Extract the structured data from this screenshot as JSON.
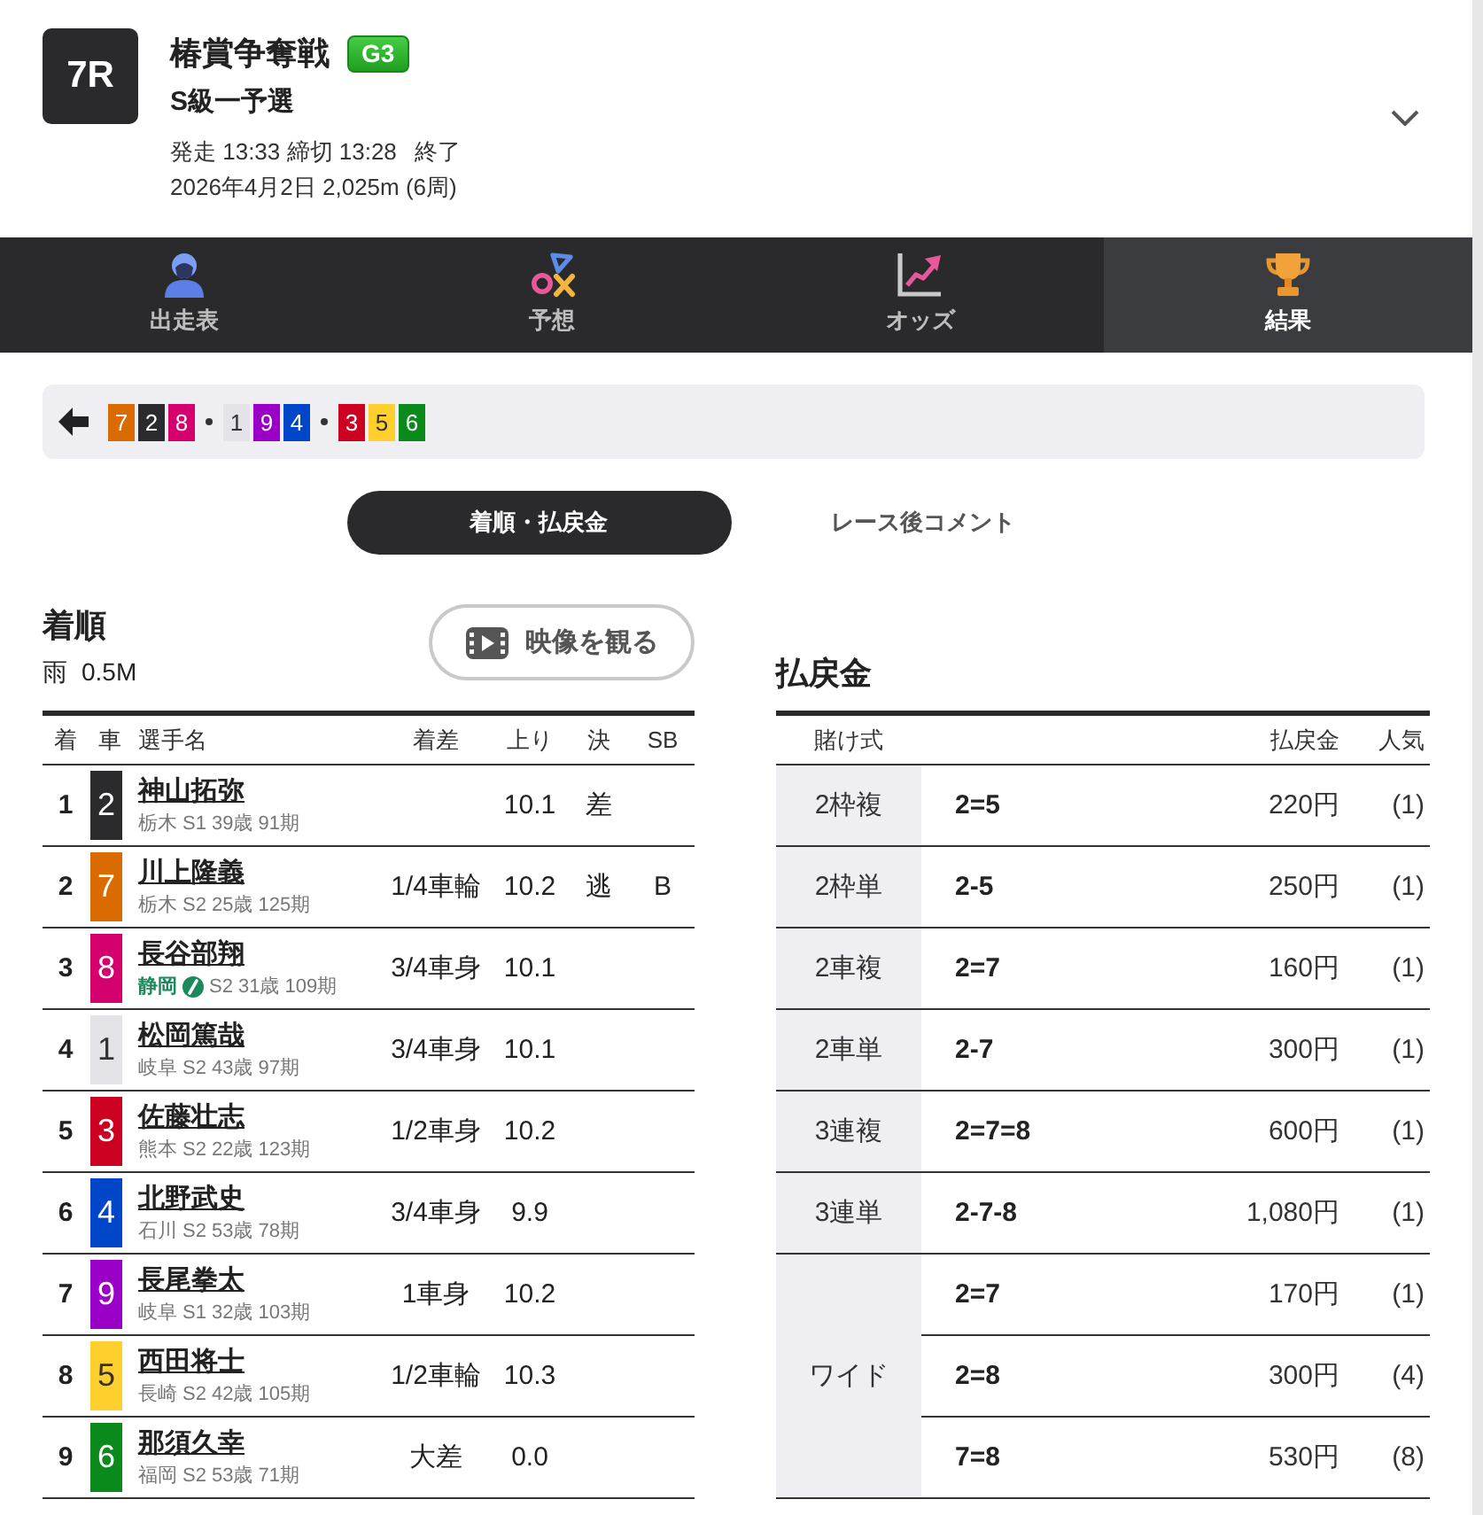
{
  "race": {
    "number": "7R",
    "title": "椿賞争奪戦",
    "grade": "G3",
    "class": "S級一予選",
    "schedule": "発走 13:33 締切 13:28",
    "status": "終了",
    "details": "2026年4月2日 2,025m (6周)"
  },
  "nav_tabs": [
    {
      "kind": "entries",
      "label": "出走表",
      "selected": false
    },
    {
      "kind": "prediction",
      "label": "予想",
      "selected": false
    },
    {
      "kind": "odds",
      "label": "オッズ",
      "selected": false
    },
    {
      "kind": "results",
      "label": "結果",
      "selected": true
    }
  ],
  "position_line": {
    "groups": [
      [
        {
          "number": "7",
          "color": "#d96b00"
        },
        {
          "number": "2",
          "color": "#2b2b2e"
        },
        {
          "number": "8",
          "color": "#d4006e"
        }
      ],
      [
        {
          "number": "1",
          "color": "#e3e3e8"
        },
        {
          "number": "9",
          "color": "#9a00c6"
        },
        {
          "number": "4",
          "color": "#0046c8"
        }
      ],
      [
        {
          "number": "3",
          "color": "#cc0020"
        },
        {
          "number": "5",
          "color": "#ffcf2e"
        },
        {
          "number": "6",
          "color": "#0b8a1c"
        }
      ]
    ]
  },
  "view_tabs": [
    {
      "label": "着順・払戻金",
      "selected": true
    },
    {
      "label": "レース後コメント",
      "selected": false
    }
  ],
  "finish": {
    "title": "着順",
    "weather": "雨",
    "wind": "0.5M",
    "video_button": "映像を観る",
    "columns": [
      "着",
      "車",
      "選手名",
      "着差",
      "上り",
      "決",
      "SB"
    ],
    "rows": [
      {
        "rank": "1",
        "car": "2",
        "color": "#2b2b2e",
        "name": "神山拓弥",
        "region": "栃木",
        "local": false,
        "profile": "S1 39歳 91期",
        "last_lap": "10.1",
        "move": "差"
      },
      {
        "rank": "2",
        "car": "7",
        "color": "#d96b00",
        "name": "川上隆義",
        "region": "栃木",
        "local": false,
        "profile": "S2 25歳 125期",
        "margin": "1/4車輪",
        "last_lap": "10.2",
        "move": "逃",
        "sb": "B"
      },
      {
        "rank": "3",
        "car": "8",
        "color": "#d4006e",
        "name": "長谷部翔",
        "region": "静岡",
        "local": true,
        "profile": "S2 31歳 109期",
        "margin": "3/4車身",
        "last_lap": "10.1"
      },
      {
        "rank": "4",
        "car": "1",
        "color": "#e3e3e8",
        "name": "松岡篤哉",
        "region": "岐阜",
        "local": false,
        "profile": "S2 43歳 97期",
        "margin": "3/4車身",
        "last_lap": "10.1"
      },
      {
        "rank": "5",
        "car": "3",
        "color": "#cc0020",
        "name": "佐藤壮志",
        "region": "熊本",
        "local": false,
        "profile": "S2 22歳 123期",
        "margin": "1/2車身",
        "last_lap": "10.2"
      },
      {
        "rank": "6",
        "car": "4",
        "color": "#0046c8",
        "name": "北野武史",
        "region": "石川",
        "local": false,
        "profile": "S2 53歳 78期",
        "margin": "3/4車身",
        "last_lap": "9.9"
      },
      {
        "rank": "7",
        "car": "9",
        "color": "#9a00c6",
        "name": "長尾拳太",
        "region": "岐阜",
        "local": false,
        "profile": "S1 32歳 103期",
        "margin": "1車身",
        "last_lap": "10.2"
      },
      {
        "rank": "8",
        "car": "5",
        "color": "#ffcf2e",
        "name": "西田将士",
        "region": "長崎",
        "local": false,
        "profile": "S2 42歳 105期",
        "margin": "1/2車輪",
        "last_lap": "10.3"
      },
      {
        "rank": "9",
        "car": "6",
        "color": "#0b8a1c",
        "name": "那須久幸",
        "region": "福岡",
        "local": false,
        "profile": "S2 53歳 71期",
        "margin": "大差",
        "last_lap": "0.0"
      }
    ]
  },
  "payouts": {
    "title": "払戻金",
    "columns": [
      "賭け式",
      "払戻金",
      "人気"
    ],
    "bets": [
      {
        "type": "2枠複",
        "results": [
          {
            "combination": "2=5",
            "amount": "220円",
            "popularity": "(1)"
          }
        ]
      },
      {
        "type": "2枠単",
        "results": [
          {
            "combination": "2-5",
            "amount": "250円",
            "popularity": "(1)"
          }
        ]
      },
      {
        "type": "2車複",
        "results": [
          {
            "combination": "2=7",
            "amount": "160円",
            "popularity": "(1)"
          }
        ]
      },
      {
        "type": "2車単",
        "results": [
          {
            "combination": "2-7",
            "amount": "300円",
            "popularity": "(1)"
          }
        ]
      },
      {
        "type": "3連複",
        "results": [
          {
            "combination": "2=7=8",
            "amount": "600円",
            "popularity": "(1)"
          }
        ]
      },
      {
        "type": "3連単",
        "results": [
          {
            "combination": "2-7-8",
            "amount": "1,080円",
            "popularity": "(1)"
          }
        ]
      },
      {
        "type": "ワイド",
        "results": [
          {
            "combination": "2=7",
            "amount": "170円",
            "popularity": "(1)"
          },
          {
            "combination": "2=8",
            "amount": "300円",
            "popularity": "(4)"
          },
          {
            "combination": "7=8",
            "amount": "530円",
            "popularity": "(8)"
          }
        ]
      }
    ]
  }
}
